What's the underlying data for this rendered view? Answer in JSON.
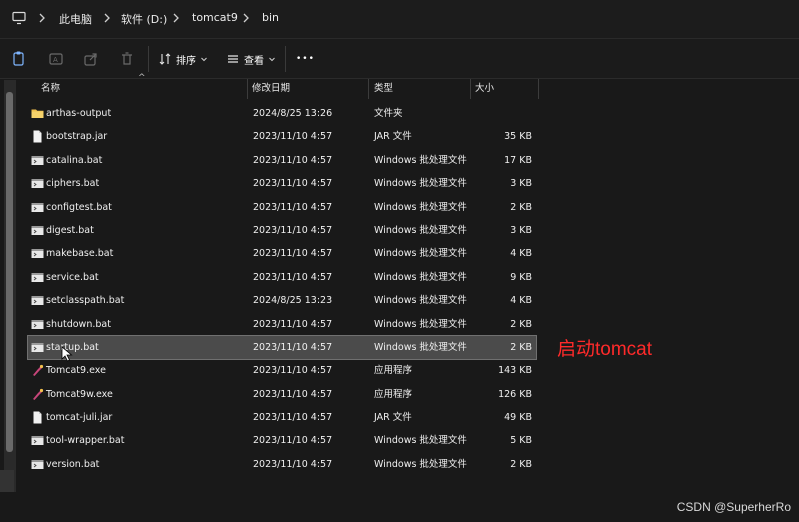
{
  "breadcrumb": {
    "items": [
      "此电脑",
      "软件 (D:)",
      "tomcat9",
      "bin"
    ]
  },
  "toolbar": {
    "sort_label": "排序",
    "view_label": "查看",
    "more_label": "•••"
  },
  "columns": {
    "name": "名称",
    "date": "修改日期",
    "type": "类型",
    "size": "大小"
  },
  "files": [
    {
      "name": "arthas-output",
      "date": "2024/8/25 13:26",
      "type": "文件夹",
      "size": "",
      "icon": "folder-icon"
    },
    {
      "name": "bootstrap.jar",
      "date": "2023/11/10 4:57",
      "type": "JAR 文件",
      "size": "35 KB",
      "icon": "file-icon"
    },
    {
      "name": "catalina.bat",
      "date": "2023/11/10 4:57",
      "type": "Windows 批处理文件",
      "size": "17 KB",
      "icon": "bat-file-icon"
    },
    {
      "name": "ciphers.bat",
      "date": "2023/11/10 4:57",
      "type": "Windows 批处理文件",
      "size": "3 KB",
      "icon": "bat-file-icon"
    },
    {
      "name": "configtest.bat",
      "date": "2023/11/10 4:57",
      "type": "Windows 批处理文件",
      "size": "2 KB",
      "icon": "bat-file-icon"
    },
    {
      "name": "digest.bat",
      "date": "2023/11/10 4:57",
      "type": "Windows 批处理文件",
      "size": "3 KB",
      "icon": "bat-file-icon"
    },
    {
      "name": "makebase.bat",
      "date": "2023/11/10 4:57",
      "type": "Windows 批处理文件",
      "size": "4 KB",
      "icon": "bat-file-icon"
    },
    {
      "name": "service.bat",
      "date": "2023/11/10 4:57",
      "type": "Windows 批处理文件",
      "size": "9 KB",
      "icon": "bat-file-icon"
    },
    {
      "name": "setclasspath.bat",
      "date": "2024/8/25 13:23",
      "type": "Windows 批处理文件",
      "size": "4 KB",
      "icon": "bat-file-icon"
    },
    {
      "name": "shutdown.bat",
      "date": "2023/11/10 4:57",
      "type": "Windows 批处理文件",
      "size": "2 KB",
      "icon": "bat-file-icon"
    },
    {
      "name": "startup.bat",
      "date": "2023/11/10 4:57",
      "type": "Windows 批处理文件",
      "size": "2 KB",
      "icon": "bat-file-icon",
      "selected": true
    },
    {
      "name": "Tomcat9.exe",
      "date": "2023/11/10 4:57",
      "type": "应用程序",
      "size": "143 KB",
      "icon": "tomcat-exe-icon"
    },
    {
      "name": "Tomcat9w.exe",
      "date": "2023/11/10 4:57",
      "type": "应用程序",
      "size": "126 KB",
      "icon": "tomcat-exe-icon"
    },
    {
      "name": "tomcat-juli.jar",
      "date": "2023/11/10 4:57",
      "type": "JAR 文件",
      "size": "49 KB",
      "icon": "file-icon"
    },
    {
      "name": "tool-wrapper.bat",
      "date": "2023/11/10 4:57",
      "type": "Windows 批处理文件",
      "size": "5 KB",
      "icon": "bat-file-icon"
    },
    {
      "name": "version.bat",
      "date": "2023/11/10 4:57",
      "type": "Windows 批处理文件",
      "size": "2 KB",
      "icon": "bat-file-icon"
    }
  ],
  "annotation": "启动tomcat",
  "watermark": "CSDN @SuperherRo",
  "colors": {
    "background": "#191919",
    "selected_row": "#4b4b4b",
    "annotation": "#ff2a2a",
    "folder": "#f2c14e"
  }
}
